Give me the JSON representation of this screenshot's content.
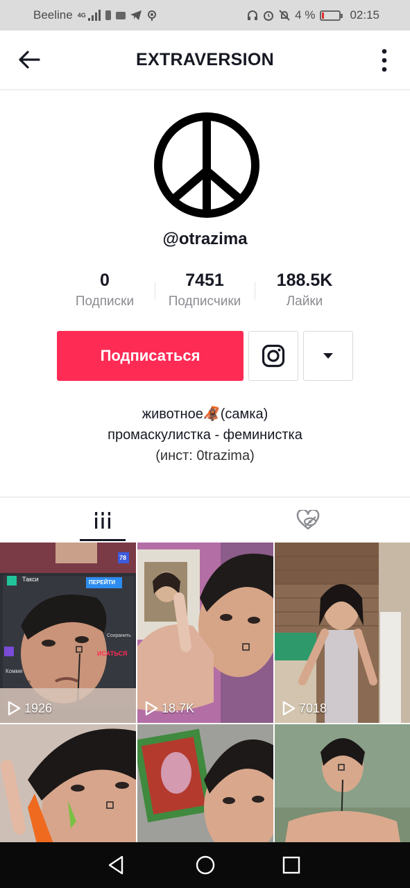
{
  "status_bar": {
    "carrier": "Beeline",
    "network": "4G",
    "battery_percent": "4 %",
    "time": "02:15"
  },
  "header": {
    "title": "EXTRAVERSION",
    "back_icon": "arrow-left-icon",
    "more_icon": "vertical-dots-icon"
  },
  "profile": {
    "avatar_icon": "peace-symbol-icon",
    "username": "@otrazima",
    "stats": [
      {
        "value": "0",
        "label": "Подписки"
      },
      {
        "value": "7451",
        "label": "Подписчики"
      },
      {
        "value": "188.5K",
        "label": "Лайки"
      }
    ],
    "follow_label": "Подписаться",
    "instagram_icon": "instagram-icon",
    "dropdown_icon": "caret-down-icon",
    "bio": {
      "line1_before": "животное",
      "line1_emoji": "🦧",
      "line1_after": "(самка)",
      "line2": "промаскулистка - феминистка",
      "line3": "(инст:  0trazima)"
    }
  },
  "tabs": [
    {
      "icon": "grid-icon",
      "active": true
    },
    {
      "icon": "hidden-likes-icon",
      "active": false
    }
  ],
  "videos": [
    {
      "views": "1926",
      "overlay_texts": [
        "ПЕРЕЙТИ",
        "Такси",
        "Сохранить",
        "ИСАТЬСЯ",
        "Комме",
        "Прекр",
        "78"
      ]
    },
    {
      "views": "18.7K"
    },
    {
      "views": "7018"
    },
    {
      "views": ""
    },
    {
      "views": ""
    },
    {
      "views": ""
    }
  ],
  "colors": {
    "accent": "#fe2c55",
    "text_primary": "#161823",
    "text_secondary": "#8a8b91",
    "status_bar_bg": "#dcdcdc",
    "system_nav_bg": "#0a0a0a"
  },
  "system_nav": [
    "back-icon",
    "home-icon",
    "recents-icon"
  ]
}
